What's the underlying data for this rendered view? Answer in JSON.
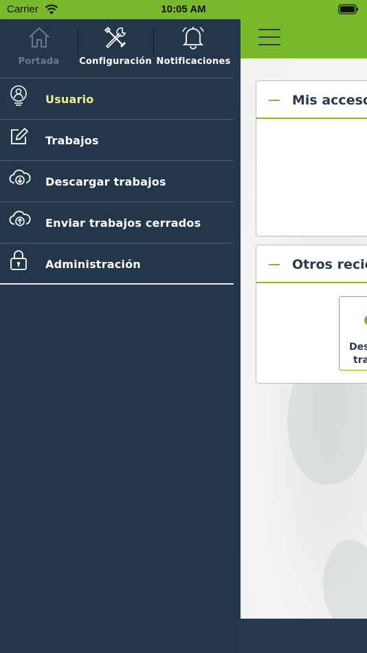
{
  "status_bar": {
    "carrier": "Carrier",
    "time": "10:05 AM"
  },
  "drawer": {
    "top": [
      {
        "label": "Portada",
        "icon": "home-icon"
      },
      {
        "label": "Configuración",
        "icon": "tools-icon"
      },
      {
        "label": "Notificaciones",
        "icon": "bell-icon"
      }
    ],
    "items": [
      {
        "label": "Usuario",
        "icon": "user-icon",
        "active": true
      },
      {
        "label": "Trabajos",
        "icon": "edit-icon"
      },
      {
        "label": "Descargar trabajos",
        "icon": "cloud-download-icon"
      },
      {
        "label": "Enviar trabajos cerrados",
        "icon": "cloud-upload-icon"
      },
      {
        "label": "Administración",
        "icon": "lock-icon"
      }
    ]
  },
  "main": {
    "cards": [
      {
        "title": "Mis accesos"
      },
      {
        "title": "Otros recie"
      }
    ],
    "tile_label_line1": "Des",
    "tile_label_line2": "tra"
  },
  "colors": {
    "accent": "#7ab82e",
    "drawer_bg": "#24374a",
    "active_label": "#f2f08a"
  }
}
